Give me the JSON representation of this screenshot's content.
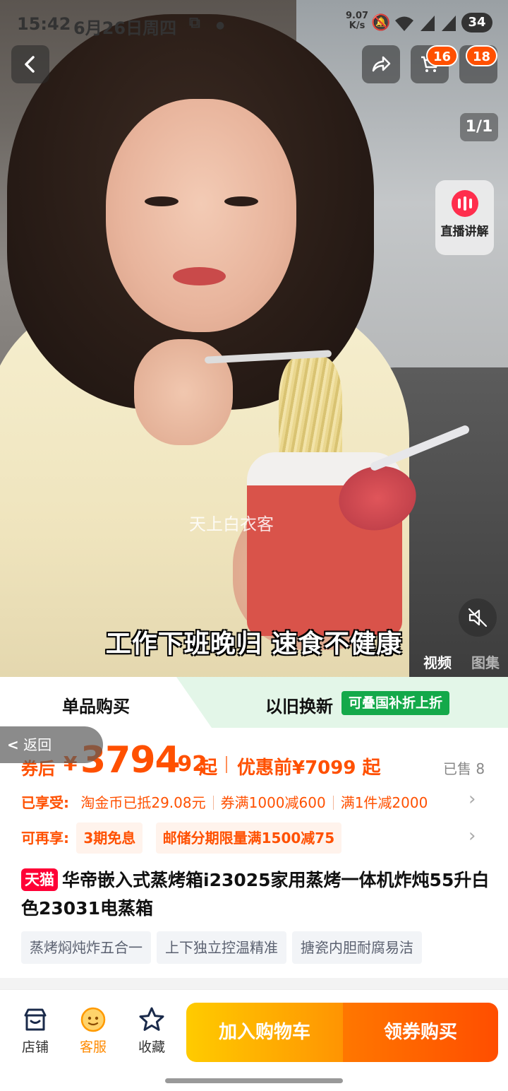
{
  "status_bar": {
    "time": "15:42",
    "date": "6月26日周四",
    "net_speed": "9.07",
    "net_unit": "K/s",
    "battery": "34"
  },
  "header": {
    "cart_badge": "16",
    "more_badge": "18",
    "pager": "1/1",
    "live_label": "直播讲解"
  },
  "media": {
    "watermark": "天上白衣客",
    "subtitle": "工作下班晚归 速食不健康",
    "tabs": [
      "视频",
      "图集"
    ]
  },
  "purchase_tabs": {
    "single": "单品购买",
    "trade_in": "以旧换新",
    "trade_in_tag": "可叠国补折上折"
  },
  "back_pill": "返回",
  "price": {
    "prefix": "券后",
    "currency": "¥",
    "integer": "3794",
    "decimal": ".92",
    "suffix": "起",
    "original": "优惠前¥7099 起",
    "sold": "已售 8"
  },
  "discounts": {
    "lead": "已享受:",
    "items": [
      "淘金币已抵29.08元",
      "券满1000减600",
      "满1件减2000"
    ]
  },
  "extra": {
    "lead": "可再享:",
    "items": [
      "3期免息",
      "邮储分期限量满1500减75"
    ]
  },
  "product": {
    "brand_tag": "天猫",
    "title": "华帝嵌入式蒸烤箱i23025家用蒸烤一体机炸炖55升白色23031电蒸箱",
    "tags": [
      "蒸烤焖炖炸五合一",
      "上下独立控温精准",
      "搪瓷内胆耐腐易洁"
    ]
  },
  "bottom_bar": {
    "shop": "店铺",
    "service": "客服",
    "favorite": "收藏",
    "add_to_cart": "加入购物车",
    "buy": "领券购买"
  },
  "colors": {
    "accent": "#ff5000",
    "tmall": "#ff0036",
    "gov_tag": "#14a94a"
  }
}
